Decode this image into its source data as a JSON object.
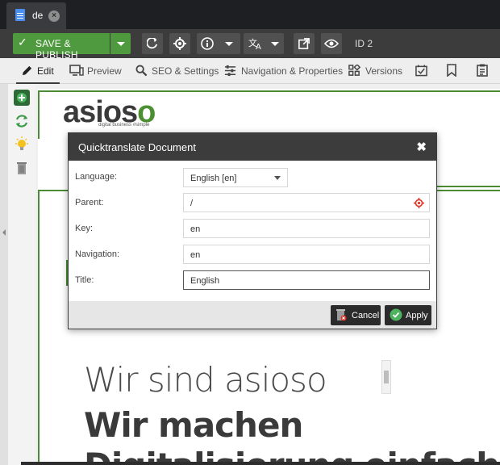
{
  "tab": {
    "label": "de",
    "doc_icon": "document-icon",
    "close_icon": "close-icon"
  },
  "toolbar": {
    "publish_label": "SAVE & PUBLISH",
    "id_label": "ID 2",
    "icons": [
      "reload-icon",
      "target-icon",
      "info-icon",
      "translate-icon",
      "open-external-icon",
      "eye-icon"
    ]
  },
  "subtabs": [
    {
      "label": "Edit",
      "icon": "pencil-icon",
      "active": true
    },
    {
      "label": "Preview",
      "icon": "monitor-icon"
    },
    {
      "label": "SEO & Settings",
      "icon": "search-icon"
    },
    {
      "label": "Navigation & Properties",
      "icon": "sliders-icon"
    },
    {
      "label": "Versions",
      "icon": "versions-icon"
    }
  ],
  "subtab_icons": [
    "calendar-check-icon",
    "bookmark-icon",
    "clipboard-icon"
  ],
  "sidebar_icons": [
    "add-icon",
    "sync-icon",
    "bulb-icon",
    "trash-icon"
  ],
  "page": {
    "logo_text": "asioso",
    "logo_tagline": "digital business #simple",
    "headline1": "Wir sind asioso",
    "headline2": "Wir machen",
    "headline3": "Digitalisierung einfach"
  },
  "modal": {
    "title": "Quicktranslate Document",
    "fields": {
      "language": {
        "label": "Language:",
        "value": "English [en]"
      },
      "parent": {
        "label": "Parent:",
        "value": "/"
      },
      "key": {
        "label": "Key:",
        "value": "en"
      },
      "navigation": {
        "label": "Navigation:",
        "value": "en"
      },
      "title": {
        "label": "Title:",
        "value": "English"
      }
    },
    "cancel_label": "Cancel",
    "apply_label": "Apply"
  },
  "colors": {
    "accent_green": "#4f9a3e",
    "dark": "#3c3c3c",
    "target_red": "#e0392b"
  }
}
